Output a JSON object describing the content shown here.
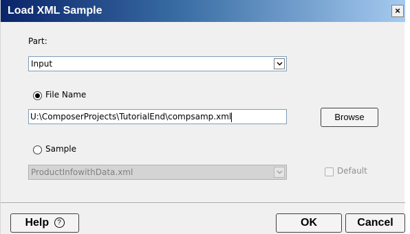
{
  "window": {
    "title": "Load XML Sample",
    "close_glyph": "×"
  },
  "part": {
    "label": "Part:",
    "value": "Input"
  },
  "file_name": {
    "label": "File Name",
    "selected": true,
    "value": "U:\\ComposerProjects\\TutorialEnd\\compsamp.xml",
    "browse_label": "Browse"
  },
  "sample": {
    "label": "Sample",
    "selected": false,
    "value": "ProductInfowithData.xml",
    "default_label": "Default",
    "default_checked": false,
    "disabled": true
  },
  "footer": {
    "help_label": "Help",
    "help_icon": "?",
    "ok_label": "OK",
    "cancel_label": "Cancel"
  },
  "colors": {
    "title_gradient_start": "#0a246a",
    "title_gradient_end": "#a6caf0",
    "dialog_bg": "#f0f0f0"
  }
}
